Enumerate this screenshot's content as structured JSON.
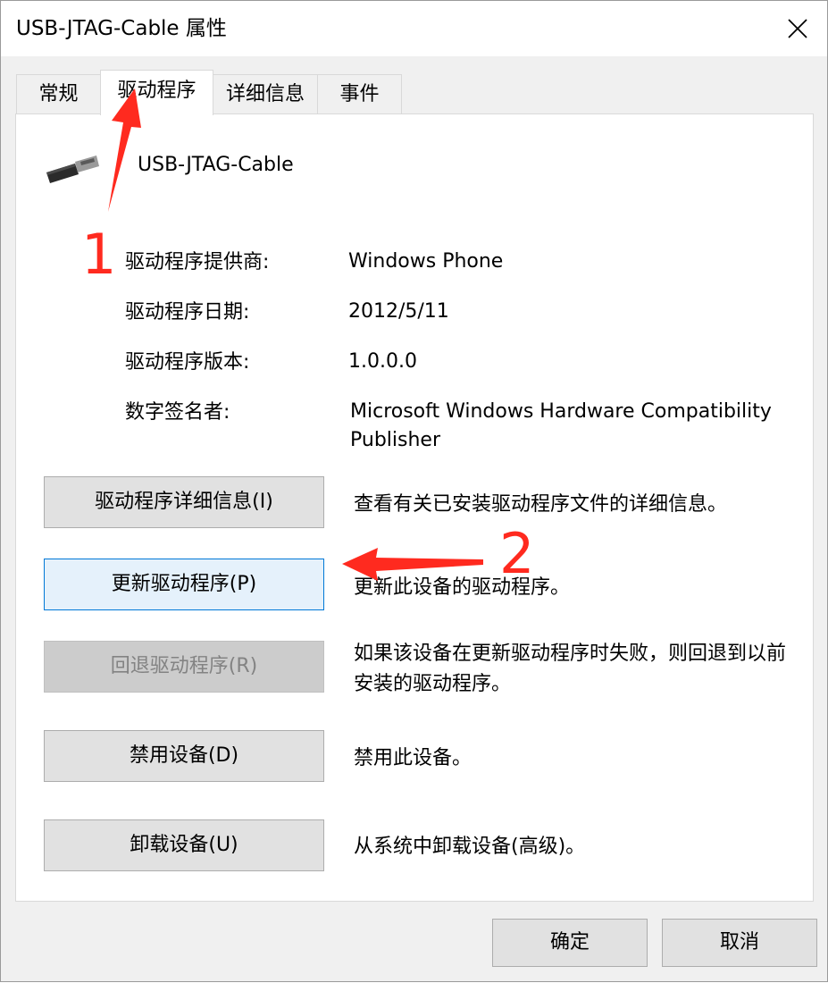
{
  "window": {
    "title": "USB-JTAG-Cable 属性"
  },
  "tabs": [
    {
      "label": "常规",
      "active": false
    },
    {
      "label": "驱动程序",
      "active": true
    },
    {
      "label": "详细信息",
      "active": false
    },
    {
      "label": "事件",
      "active": false
    }
  ],
  "device": {
    "name": "USB-JTAG-Cable",
    "icon": "usb-connector-icon"
  },
  "driver_info": [
    {
      "label": "驱动程序提供商:",
      "value": "Windows Phone"
    },
    {
      "label": "驱动程序日期:",
      "value": "2012/5/11"
    },
    {
      "label": "驱动程序版本:",
      "value": "1.0.0.0"
    },
    {
      "label": "数字签名者:",
      "value": "Microsoft Windows Hardware Compatibility Publisher"
    }
  ],
  "actions": [
    {
      "button": "驱动程序详细信息(I)",
      "description": "查看有关已安装驱动程序文件的详细信息。",
      "state": "normal"
    },
    {
      "button": "更新驱动程序(P)",
      "description": "更新此设备的驱动程序。",
      "state": "focused"
    },
    {
      "button": "回退驱动程序(R)",
      "description": "如果该设备在更新驱动程序时失败，则回退到以前安装的驱动程序。",
      "state": "disabled"
    },
    {
      "button": "禁用设备(D)",
      "description": "禁用此设备。",
      "state": "normal"
    },
    {
      "button": "卸载设备(U)",
      "description": "从系统中卸载设备(高级)。",
      "state": "normal"
    }
  ],
  "footer": {
    "ok_label": "确定",
    "cancel_label": "取消"
  },
  "annotations": {
    "step1": "1",
    "step2": "2",
    "color": "#ff2a1f"
  }
}
